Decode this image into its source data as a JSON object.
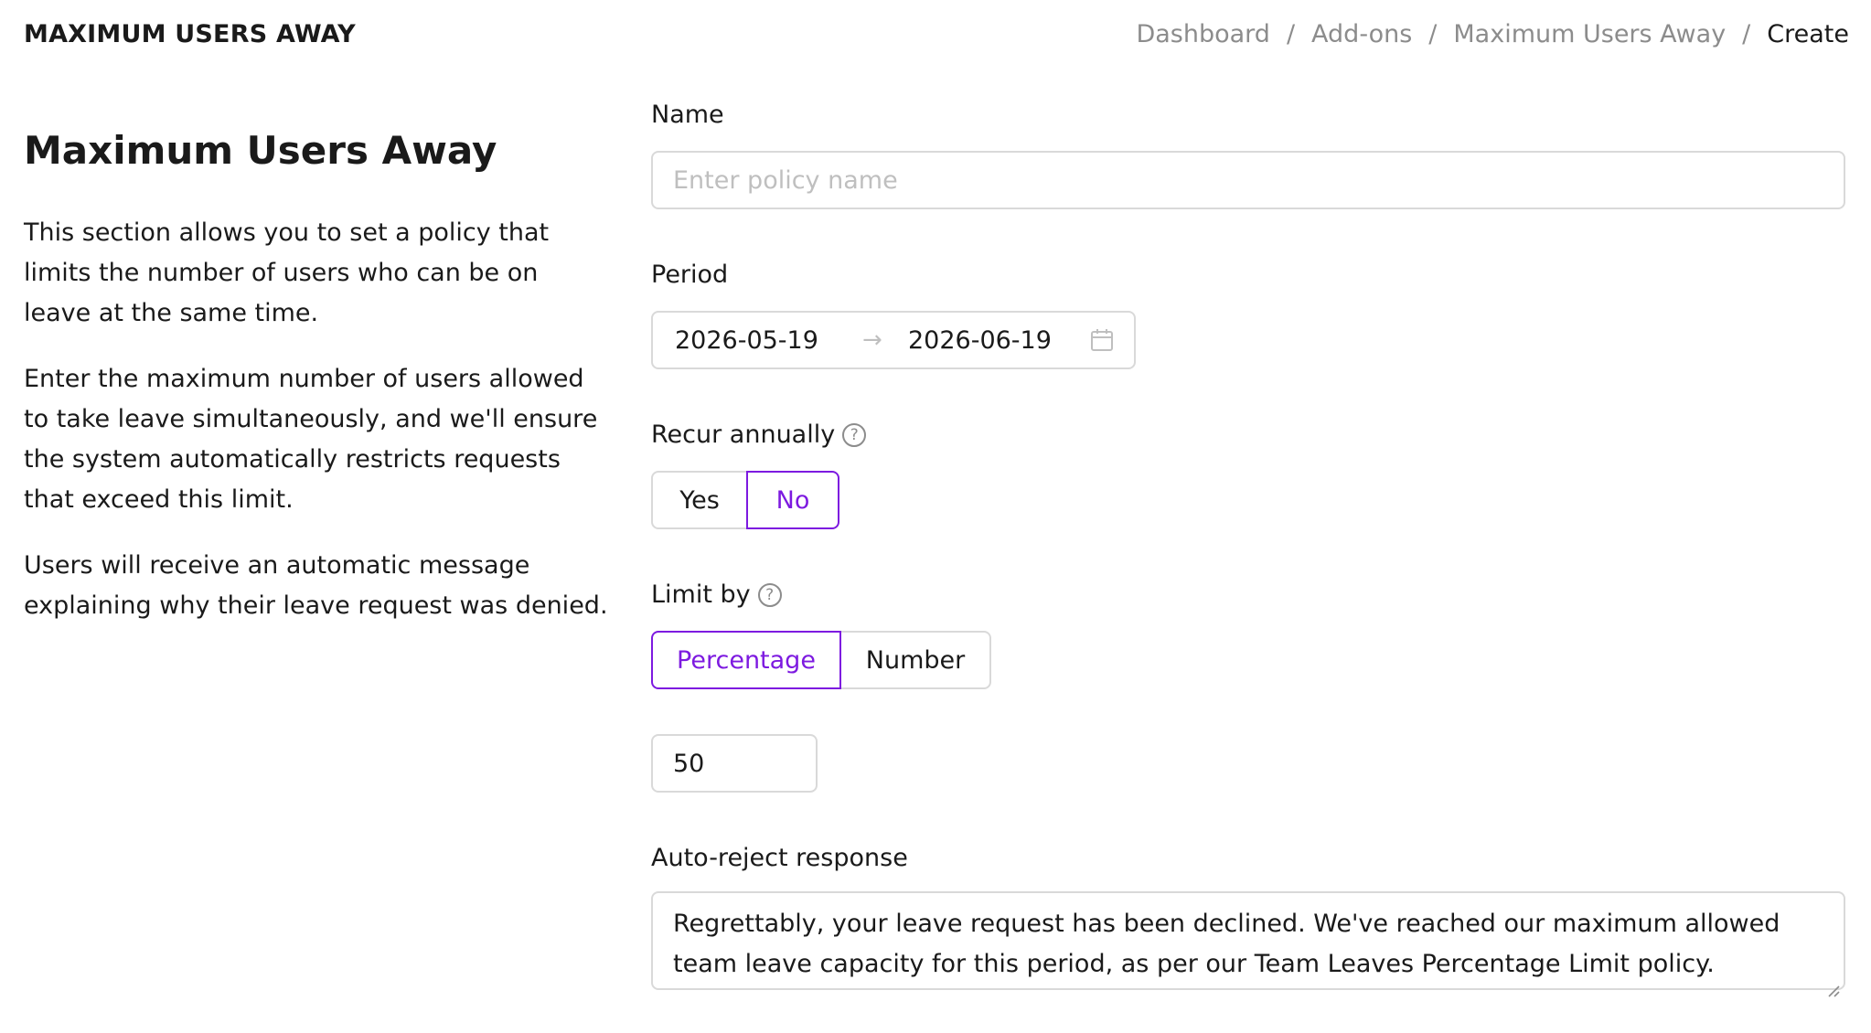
{
  "header": {
    "app_title": "MAXIMUM USERS AWAY",
    "breadcrumb": [
      "Dashboard",
      "Add-ons",
      "Maximum Users Away",
      "Create"
    ],
    "separator": "/"
  },
  "intro": {
    "title": "Maximum Users Away",
    "paragraphs": [
      "This section allows you to set a policy that limits the number of users who can be on leave at the same time.",
      "Enter the maximum number of users allowed to take leave simultaneously, and we'll ensure the system automatically restricts requests that exceed this limit.",
      "Users will receive an automatic message explaining why their leave request was denied."
    ]
  },
  "form": {
    "name": {
      "label": "Name",
      "value": "",
      "placeholder": "Enter policy name"
    },
    "period": {
      "label": "Period",
      "start": "2026-05-19",
      "arrow": "→",
      "end": "2026-06-19",
      "icon": "calendar-icon"
    },
    "recur_annually": {
      "label": "Recur annually",
      "help_glyph": "?",
      "options": [
        "Yes",
        "No"
      ],
      "selected": "No"
    },
    "limit_by": {
      "label": "Limit by",
      "help_glyph": "?",
      "options": [
        "Percentage",
        "Number"
      ],
      "selected": "Percentage"
    },
    "limit_value": {
      "value": "50"
    },
    "auto_reject": {
      "label": "Auto-reject response",
      "value": "Regrettably, your leave request has been declined. We've reached our maximum allowed team leave capacity for this period, as per our Team Leaves Percentage Limit policy."
    }
  },
  "colors": {
    "accent": "#7d1ae0",
    "border": "#d9d9d9",
    "muted_text": "#8c8c8c",
    "placeholder": "#bfbfbf"
  }
}
